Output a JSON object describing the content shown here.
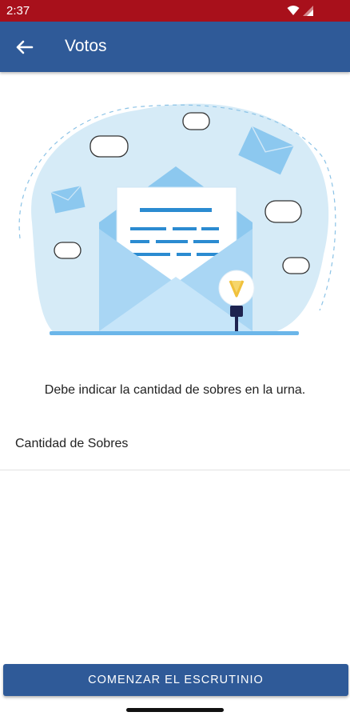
{
  "status_bar": {
    "time": "2:37",
    "icons": [
      "wifi-icon",
      "signal-icon"
    ]
  },
  "app_bar": {
    "title": "Votos",
    "back_icon": "arrow-left-icon"
  },
  "illustration": {
    "description_icon": "envelope-with-letter-icon"
  },
  "main": {
    "instruction": "Debe indicar la cantidad de sobres en la urna.",
    "field_label": "Cantidad de Sobres"
  },
  "footer": {
    "button_label": "COMENZAR EL ESCRUTINIO"
  },
  "colors": {
    "status_bar": "#a8101b",
    "app_bar": "#2f5a98",
    "accent_light": "#d6ebf7"
  }
}
